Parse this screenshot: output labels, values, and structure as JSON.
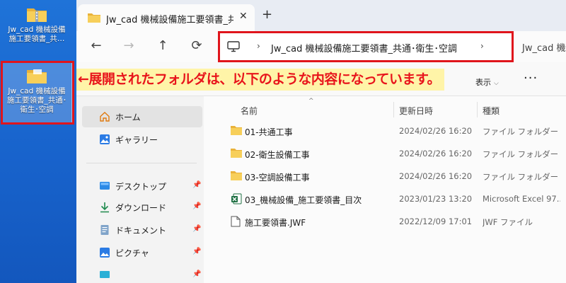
{
  "desktop": {
    "icon1_label_line1": "Jw_cad 機械設備",
    "icon1_label_line2": "施工要領書_共…",
    "icon2_label_line1": "Jw_cad 機械設備",
    "icon2_label_line2": "施工要領書_共通･",
    "icon2_label_line3": "衛生･空調"
  },
  "window": {
    "tab_title": "Jw_cad 機械設備施工要領書_共",
    "tab_close": "✕",
    "new_tab": "+",
    "back": "←",
    "forward": "→",
    "up": "↑",
    "refresh": "⟳",
    "address_sep": "›",
    "address_path": "Jw_cad 機械設備施工要領書_共通･衛生･空調",
    "search_placeholder": "Jw_cad 機械"
  },
  "annotation": "←展開されたフォルダは、以下のような内容になっています。",
  "toolbar": {
    "view_label": "表示",
    "view_chevron": "⌵",
    "more": "···"
  },
  "nav": {
    "home": "ホーム",
    "gallery": "ギャラリー",
    "desktop": "デスクトップ",
    "downloads": "ダウンロード",
    "documents": "ドキュメント",
    "pictures": "ピクチャ",
    "pin": "📌"
  },
  "columns": {
    "name": "名前",
    "modified": "更新日時",
    "type": "種類",
    "sort_arrow": "^"
  },
  "files": [
    {
      "name": "01-共通工事",
      "modified": "2024/02/26 16:20",
      "type": "ファイル フォルダー",
      "icon": "folder-icon"
    },
    {
      "name": "02-衛生設備工事",
      "modified": "2024/02/26 16:20",
      "type": "ファイル フォルダー",
      "icon": "folder-icon"
    },
    {
      "name": "03-空調設備工事",
      "modified": "2024/02/26 16:20",
      "type": "ファイル フォルダー",
      "icon": "folder-icon"
    },
    {
      "name": "03_機械設備_施工要領書_目次",
      "modified": "2023/01/23 13:20",
      "type": "Microsoft Excel 97...",
      "icon": "excel-icon"
    },
    {
      "name": "施工要領書.JWF",
      "modified": "2022/12/09 17:01",
      "type": "JWF ファイル",
      "icon": "file-icon"
    }
  ],
  "colors": {
    "highlight_red": "#e0151c",
    "annotation_bg": "#fff4a8",
    "desktop_blue": "#1863cc",
    "folder_yellow": "#f4c242"
  }
}
